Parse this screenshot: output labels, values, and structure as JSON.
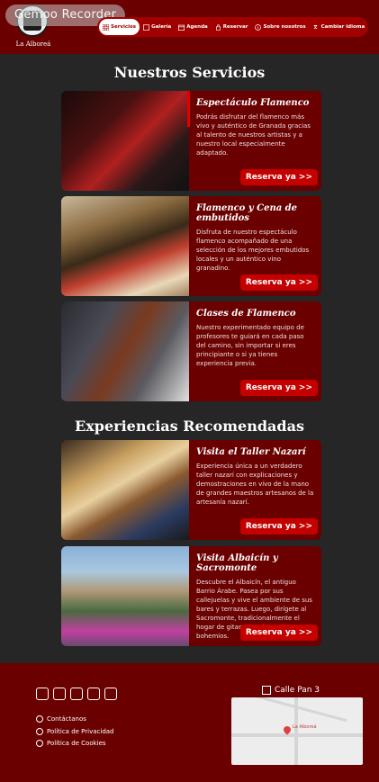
{
  "header": {
    "watermark": "Gemoo Recorder",
    "logo_name": "La Alboreá",
    "nav": [
      {
        "label": "Servicios",
        "icon": "grid-icon",
        "active": true
      },
      {
        "label": "Galería",
        "icon": "gallery-icon"
      },
      {
        "label": "Agenda",
        "icon": "calendar-icon"
      },
      {
        "label": "Reservar",
        "icon": "hand-icon"
      },
      {
        "label": "Sobre nosotros",
        "icon": "info-icon"
      },
      {
        "label": "Cambiar idioma",
        "icon": "translate-icon"
      }
    ]
  },
  "services": {
    "title": "Nuestros Servicios",
    "cards": [
      {
        "title": "Espectáculo Flamenco",
        "text": "Podrás disfrutar del flamenco más vivo y auténtico de Granada gracias al talento de nuestros artistas y a nuestro local especialmente adaptado.",
        "button": "Reserva ya >>"
      },
      {
        "title": "Flamenco y Cena de embutidos",
        "text": "Disfruta de nuestro espectáculo flamenco acompañado de una selección de los mejores embutidos locales y un auténtico vino granadino.",
        "button": "Reserva ya >>"
      },
      {
        "title": "Clases de Flamenco",
        "text": "Nuestro experimentado equipo de profesores te guiará en cada paso del camino, sin importar si eres principiante o si ya tienes experiencia previa.",
        "button": "Reserva ya >>"
      }
    ]
  },
  "experiences": {
    "title": "Experiencias Recomendadas",
    "cards": [
      {
        "title": "Visita el Taller Nazarí",
        "text": "Experiencia única a un verdadero taller nazarí con explicaciones y demostraciones en vivo de la mano de grandes maestros artesanos de la artesanía nazarí.",
        "button": "Reserva ya >>"
      },
      {
        "title": "Visita Albaicín y Sacromonte",
        "text": "Descubre el Albaicín, el antiguo Barrio Árabe. Pasea por sus callejuelas y vive el ambiente de sus bares y terrazas. Luego, dirígete al Sacromonte, tradicionalmente el hogar de gitanos, artistas y bohemios.",
        "button": "Reserva ya >>"
      }
    ]
  },
  "footer": {
    "social_icons": [
      "facebook-icon",
      "instagram-icon",
      "twitter-icon",
      "youtube-icon",
      "tiktok-icon"
    ],
    "links": [
      "Contáctanos",
      "Política de Privacidad",
      "Política de Cookies"
    ],
    "address": "Calle Pan 3",
    "map_label": "La Alboreá"
  }
}
